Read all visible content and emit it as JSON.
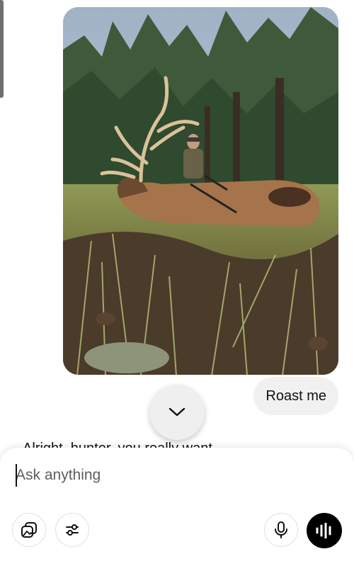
{
  "conversation": {
    "image_alt": "Hunter kneeling behind a large bull elk with a compound bow in a pine forest",
    "user_message": "Roast me",
    "assistant_partial_reply": "Alright, hunter, you really want..."
  },
  "composer": {
    "placeholder": "Ask anything"
  },
  "icons": {
    "scroll_down": "chevron-down-icon",
    "attach": "gallery-icon",
    "tools": "sliders-icon",
    "mic": "microphone-icon",
    "voice": "voice-waveform-icon"
  },
  "colors": {
    "bubble_bg": "#f1f1f1",
    "voice_button_bg": "#000000",
    "placeholder": "#5d5d5d"
  }
}
